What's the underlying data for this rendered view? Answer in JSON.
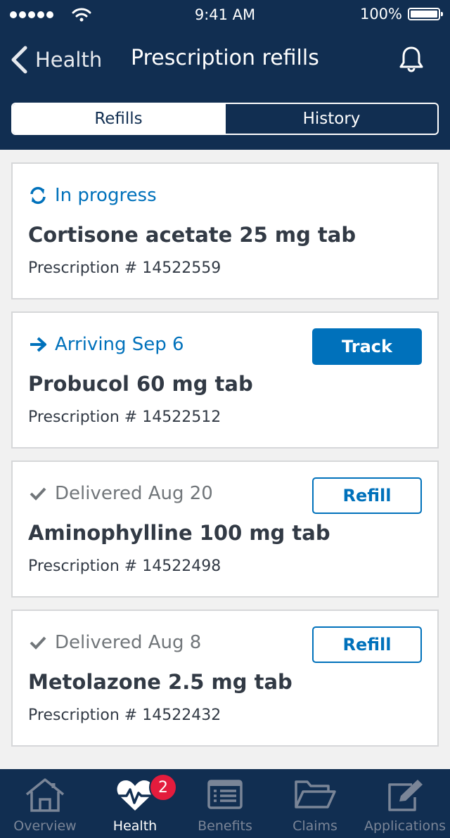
{
  "status_bar": {
    "time": "9:41 AM",
    "battery": "100%"
  },
  "nav": {
    "back_label": "Health",
    "title": "Prescription refills"
  },
  "segments": {
    "refills": "Refills",
    "history": "History"
  },
  "cards": [
    {
      "status": "In progress",
      "status_icon": "refresh-icon",
      "drug": "Cortisone acetate 25 mg tab",
      "rx": "Prescription # 14522559",
      "button": null
    },
    {
      "status": "Arriving Sep 6",
      "status_icon": "arrow-right-icon",
      "drug": "Probucol 60 mg tab",
      "rx": "Prescription # 14522512",
      "button": "Track"
    },
    {
      "status": "Delivered Aug 20",
      "status_icon": "check-icon",
      "drug": "Aminophylline 100 mg tab",
      "rx": "Prescription # 14522498",
      "button": "Refill"
    },
    {
      "status": "Delivered Aug 8",
      "status_icon": "check-icon",
      "drug": "Metolazone 2.5 mg tab",
      "rx": "Prescription # 14522432",
      "button": "Refill"
    }
  ],
  "tabbar": {
    "items": [
      {
        "label": "Overview",
        "icon": "home-icon"
      },
      {
        "label": "Health",
        "icon": "heartbeat-icon"
      },
      {
        "label": "Benefits",
        "icon": "list-icon"
      },
      {
        "label": "Claims",
        "icon": "folder-icon"
      },
      {
        "label": "Applications",
        "icon": "edit-icon"
      }
    ],
    "active": "Health",
    "badge": "2"
  },
  "colors": {
    "navy": "#112e51",
    "accent": "#0071bb",
    "badge": "#e31c3d"
  }
}
